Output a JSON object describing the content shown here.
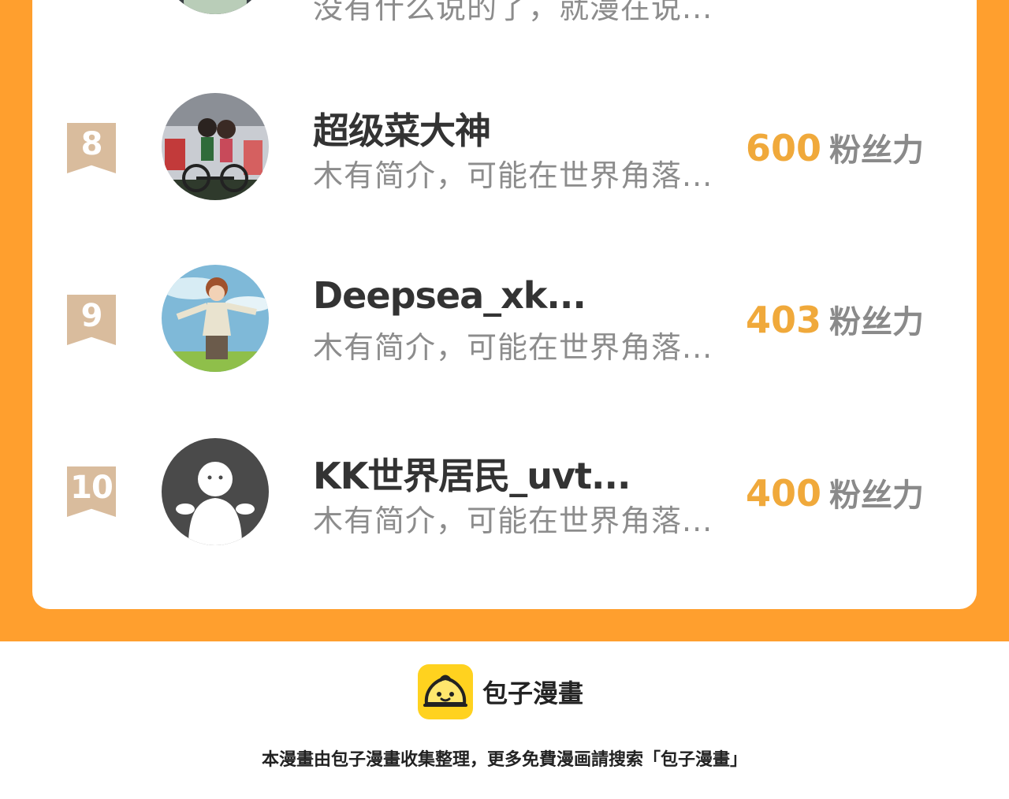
{
  "ranking": {
    "partial_row": {
      "bio": "没有什么说的了，就漫在说..."
    },
    "rows": [
      {
        "rank": "8",
        "name": "超级菜大神",
        "bio": "木有简介，可能在世界角落...",
        "score": "600",
        "unit": "粉丝力",
        "avatar": "couple-figurine-photo"
      },
      {
        "rank": "9",
        "name": "Deepsea_xk...",
        "bio": "木有简介，可能在世界角落...",
        "score": "403",
        "unit": "粉丝力",
        "avatar": "anime-boy-illustration"
      },
      {
        "rank": "10",
        "name": "KK世界居民_uvt...",
        "bio": "木有简介，可能在世界角落...",
        "score": "400",
        "unit": "粉丝力",
        "avatar": "default-user-icon"
      }
    ]
  },
  "footer": {
    "brand_name": "包子漫畫",
    "note": "本漫畫由包子漫畫收集整理，更多免費漫画請搜索「包子漫畫」"
  },
  "colors": {
    "accent_orange": "#ff9f2e",
    "score_gold": "#f0a93b",
    "rank_flag": "#d9bc9d",
    "brand_yellow": "#ffd21f"
  }
}
